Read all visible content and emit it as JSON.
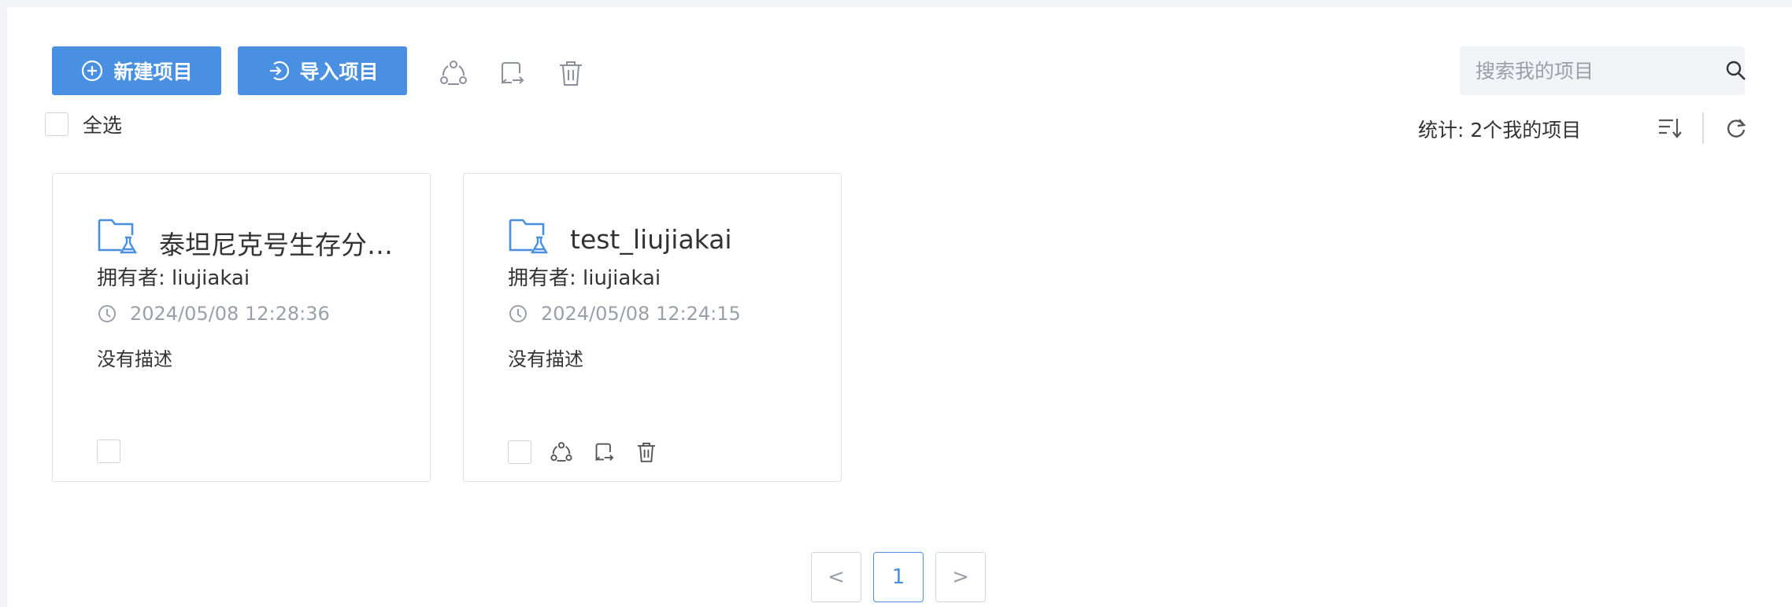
{
  "toolbar": {
    "new_project_label": "新建项目",
    "import_project_label": "导入项目",
    "search_placeholder": "搜索我的项目"
  },
  "list_header": {
    "select_all_label": "全选",
    "stats_text": "统计: 2个我的项目"
  },
  "projects": [
    {
      "title": "泰坦尼克号生存分析...",
      "owner": "拥有者: liujiakai",
      "time": "2024/05/08 12:28:36",
      "description": "没有描述"
    },
    {
      "title": "test_liujiakai",
      "owner": "拥有者: liujiakai",
      "time": "2024/05/08 12:24:15",
      "description": "没有描述"
    }
  ],
  "pagination": {
    "prev": "<",
    "current": "1",
    "next": ">"
  },
  "icons": {
    "new": "plus-circle-icon",
    "import": "arrow-in-icon",
    "share": "share-users-icon",
    "export": "export-icon",
    "delete": "trash-icon",
    "search": "search-icon",
    "sort": "sort-icon",
    "refresh": "refresh-icon",
    "folder": "project-folder-icon",
    "clock": "clock-icon"
  },
  "colors": {
    "primary": "#4a90e2",
    "icon_gray": "#8a9099",
    "border": "#dfe3e8",
    "page_bg": "#f2f3f7"
  }
}
